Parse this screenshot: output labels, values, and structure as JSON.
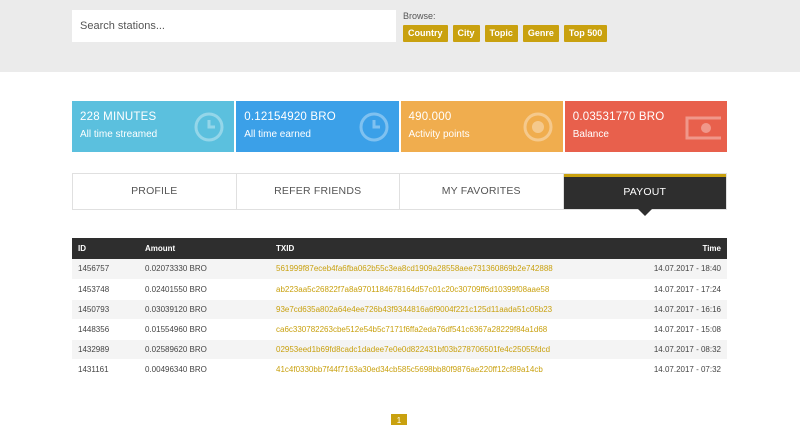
{
  "search": {
    "placeholder": "Search stations..."
  },
  "browse": {
    "label": "Browse:",
    "buttons": [
      "Country",
      "City",
      "Topic",
      "Genre",
      "Top 500"
    ]
  },
  "stats": [
    {
      "value": "228 MINUTES",
      "label": "All time streamed",
      "icon": "clock-icon",
      "color": "#5bc0de"
    },
    {
      "value": "0.12154920 BRO",
      "label": "All time earned",
      "icon": "clock-icon",
      "color": "#3ba0e8"
    },
    {
      "value": "490.000",
      "label": "Activity points",
      "icon": "target-icon",
      "color": "#f0ad4e"
    },
    {
      "value": "0.03531770 BRO",
      "label": "Balance",
      "icon": "banknote-icon",
      "color": "#e8604c"
    }
  ],
  "tabs": [
    "PROFILE",
    "REFER FRIENDS",
    "MY FAVORITES",
    "PAYOUT"
  ],
  "table": {
    "headers": {
      "id": "ID",
      "amount": "Amount",
      "txid": "TXID",
      "time": "Time"
    },
    "rows": [
      {
        "id": "1456757",
        "amount": "0.02073330 BRO",
        "txid": "561999f87eceb4fa6fba062b55c3ea8cd1909a28558aee731360869b2e742888",
        "time": "14.07.2017 - 18:40"
      },
      {
        "id": "1453748",
        "amount": "0.02401550 BRO",
        "txid": "ab223aa5c26822f7a8a9701184678164d57c01c20c30709ff6d10399f08aae58",
        "time": "14.07.2017 - 17:24"
      },
      {
        "id": "1450793",
        "amount": "0.03039120 BRO",
        "txid": "93e7cd635a802a64e4ee726b43f9344816a6f9004f221c125d11aada51c05b23",
        "time": "14.07.2017 - 16:16"
      },
      {
        "id": "1448356",
        "amount": "0.01554960 BRO",
        "txid": "ca6c330782263cbe512e54b5c7171f6ffa2eda76df541c6367a28229f84a1d68",
        "time": "14.07.2017 - 15:08"
      },
      {
        "id": "1432989",
        "amount": "0.02589620 BRO",
        "txid": "02953eed1b69fd8cadc1dadee7e0e0d822431bf03b278706501fe4c25055fdcd",
        "time": "14.07.2017 - 08:32"
      },
      {
        "id": "1431161",
        "amount": "0.00496340 BRO",
        "txid": "41c4f0330bb7f44f7163a30ed34cb585c5698bb80f9876ae220ff12cf89a14cb",
        "time": "14.07.2017 - 07:32"
      }
    ]
  },
  "pagination": {
    "current": "1"
  },
  "colors": {
    "accent": "#c9a10f",
    "dark": "#2e2e2e"
  }
}
